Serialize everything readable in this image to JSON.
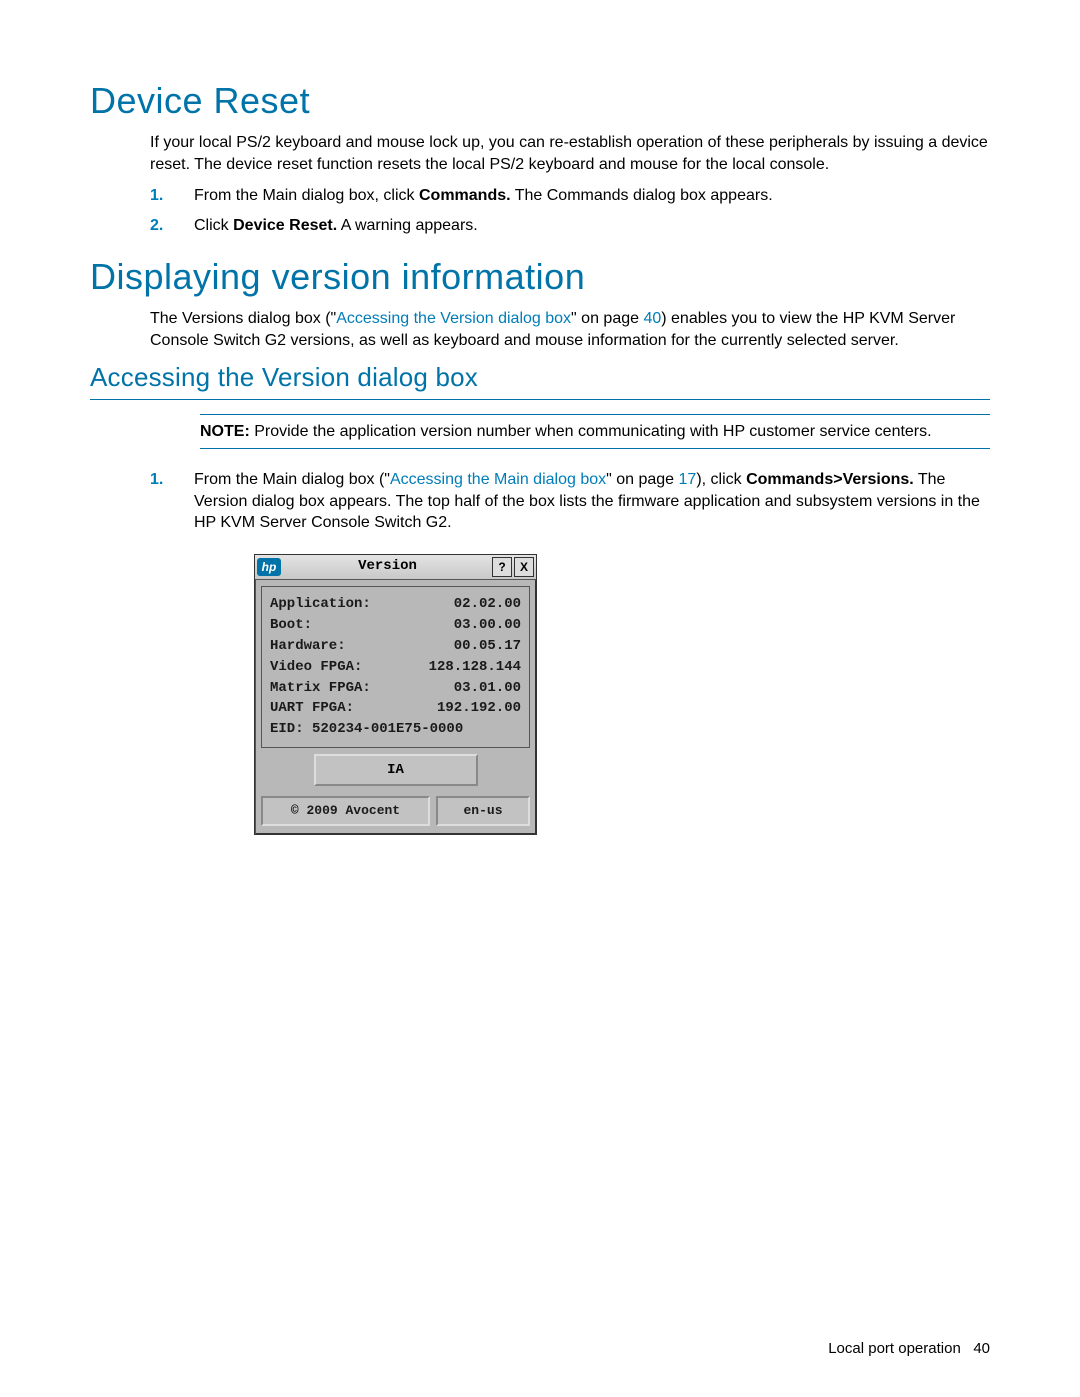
{
  "h1a": "Device Reset",
  "p1": "If your local PS/2 keyboard and mouse lock up, you can re-establish operation of these peripherals by issuing a device reset. The device reset function resets the local PS/2 keyboard and mouse for the local console.",
  "steps_a": {
    "n1": "1.",
    "s1a": "From the Main dialog box, click ",
    "s1b": "Commands.",
    "s1c": " The Commands dialog box appears.",
    "n2": "2.",
    "s2a": "Click ",
    "s2b": "Device Reset.",
    "s2c": " A warning appears."
  },
  "h1b": "Displaying version information",
  "p2a": "The Versions dialog box (\"",
  "p2link": "Accessing the Version dialog box",
  "p2b": "\" on page ",
  "p2page": "40",
  "p2c": ") enables you to view the HP KVM Server Console Switch G2 versions, as well as keyboard and mouse information for the currently selected server.",
  "h2a": "Accessing the Version dialog box",
  "note_label": "NOTE:",
  "note_text": "  Provide the application version number when communicating with HP customer service centers.",
  "steps_b": {
    "n1": "1.",
    "s1a": "From the Main dialog box (\"",
    "s1link": "Accessing the Main dialog box",
    "s1b": "\" on page ",
    "s1page": "17",
    "s1c": "), click ",
    "s1d": "Commands>Versions.",
    "s1e": " The Version dialog box appears. The top half of the box lists the firmware application and subsystem versions in the HP KVM Server Console Switch G2."
  },
  "dialog": {
    "logo": "hp",
    "title": "Version",
    "help": "?",
    "close": "X",
    "rows": [
      {
        "label": "Application:",
        "val": "02.02.00"
      },
      {
        "label": "Boot:",
        "val": "03.00.00"
      },
      {
        "label": "Hardware:",
        "val": "00.05.17"
      },
      {
        "label": "Video FPGA:",
        "val": "128.128.144"
      },
      {
        "label": "Matrix FPGA:",
        "val": "03.01.00"
      },
      {
        "label": "UART FPGA:",
        "val": "192.192.00"
      }
    ],
    "eid": "EID:   520234-001E75-0000",
    "ia_btn": "IA",
    "copyright": "© 2009 Avocent",
    "lang": "en-us"
  },
  "footer_text": "Local port operation",
  "footer_page": "40"
}
